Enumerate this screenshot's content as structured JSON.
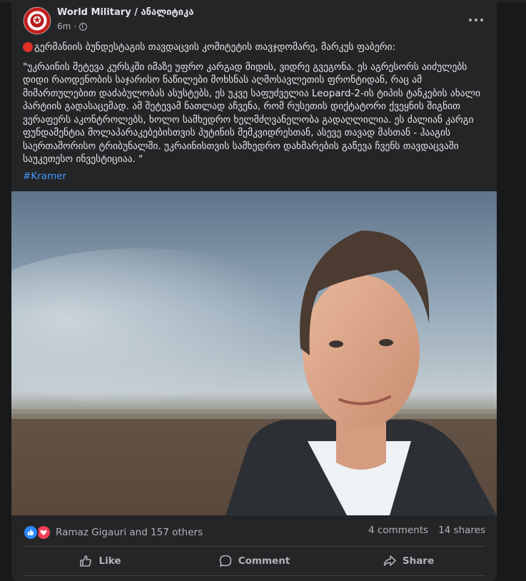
{
  "post": {
    "page_name": "World Military / ანალიტიკა",
    "time": "6m",
    "separator": "·",
    "intro": "გერმანიის ბუნდესტაგის თავდაცვის კომიტეტის თავჯდომარე, მარკუს ფაბერი:",
    "quote": "\"უკრაინის შეტევა კურსკში იმაზე უფრო კარგად მიდის, ვიდრე გვეგონა. ეს აგრესორს აიძულებს დიდი რაოდენობის საჯარისო ნაწილები მოხსნას აღმოსავლეთის ფრონტიდან, რაც ამ მიმართულებით დაძაბულობას ასუსტებს, ეს უკვე საფუძველია Leopard-2-ის ტიპის ტანკების ახალი პარტიის გადასაცემად. ამ შეტევამ ნათლად აჩვენა, რომ რუსეთის დიქტატორი ქვეყნის შიგნით ვერაფერს აკონტროლებს, ხოლო სამხედრო ხელმძღვანელობა გადაღლილია. ეს ძალიან კარგი ფუნდამენტია მოლაპარაკებებისთვის პუტინის მემკვიდრესთან, ასევე თავად მასთან - ჰააგის საერთაშორისო ტრიბუნალში. უკრაინისთვის სამხედრო დახმარების გაწევა ჩვენს თავდაცვაში საუკეთესო ინვესტიციაა. \"",
    "hashtag": "#Kramer"
  },
  "stats": {
    "reactors": "Ramaz Gigauri and 157 others",
    "comments": "4 comments",
    "shares": "14 shares"
  },
  "actions": {
    "like": "Like",
    "comment": "Comment",
    "share": "Share"
  },
  "icons": {
    "avatar": "military-emblem-icon",
    "privacy": "globe-icon",
    "menu": "more-horizontal-icon",
    "intro": "red-circle-icon",
    "like_reaction": "thumbs-up-icon",
    "love_reaction": "heart-icon"
  },
  "colors": {
    "background": "#18191a",
    "card": "#242526",
    "text": "#e4e6eb",
    "secondary_text": "#b0b3b8",
    "link": "#4599ff",
    "like_blue": "#2d88ff",
    "love_red": "#f33e58"
  }
}
